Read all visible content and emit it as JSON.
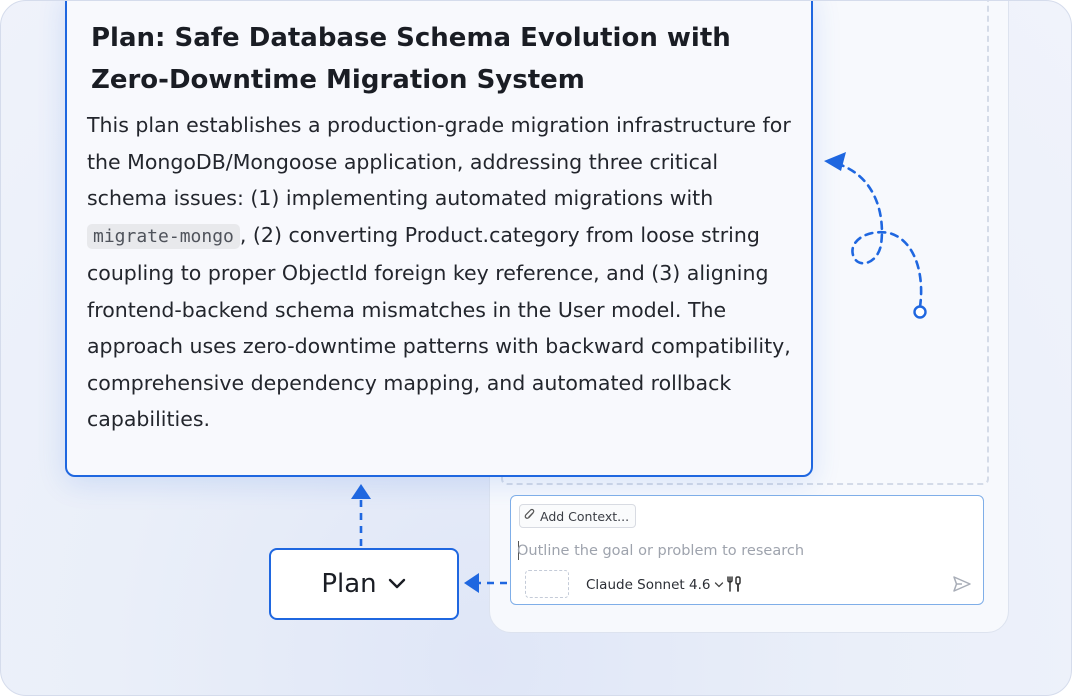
{
  "plan_card": {
    "title": "Plan: Safe Database Schema Evolution with Zero-Downtime Migration System",
    "body_before_code": "This plan establishes a production-grade migration infrastructure for the MongoDB/Mongoose application, addressing three critical schema issues: (1) implementing automated migrations with ",
    "code": "migrate-mongo",
    "body_after_code": ", (2) converting Product.category from loose string coupling to proper ObjectId foreign key reference, and (3) aligning frontend-backend schema mismatches in the User model. The approach uses zero-downtime patterns with backward compatibility, comprehensive dependency mapping, and automated rollback capabilities."
  },
  "mode_button": {
    "label": "Plan",
    "icon": "chevron-down-icon"
  },
  "composer": {
    "add_context_label": "Add Context...",
    "add_context_icon": "paperclip-icon",
    "goal_placeholder": "Outline the goal or problem to research",
    "goal_value": "",
    "model_label": "Claude Sonnet 4.6",
    "model_icon": "chevron-down-icon",
    "tools_icon": "tools-icon",
    "send_icon": "send-icon"
  },
  "colors": {
    "accent": "#1f67e0",
    "card_bg": "#f8f9fd",
    "canvas_bg": "#eaeff9"
  }
}
